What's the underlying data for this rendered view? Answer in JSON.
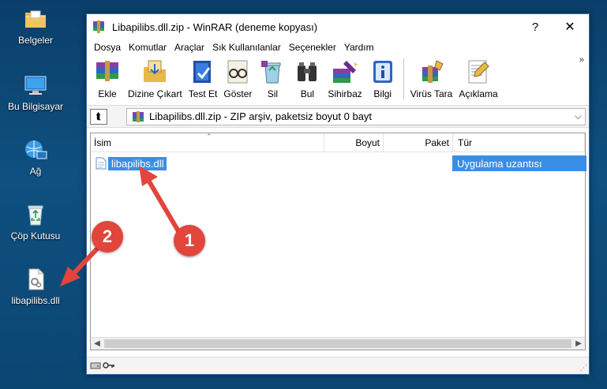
{
  "desktop": {
    "icons": [
      {
        "label": "Belgeler",
        "icon": "folder-documents-icon"
      },
      {
        "label": "Bu Bilgisayar",
        "icon": "computer-icon"
      },
      {
        "label": "Ağ",
        "icon": "network-icon"
      },
      {
        "label": "Çöp Kutusu",
        "icon": "recycle-bin-icon"
      },
      {
        "label": "libapilibs.dll",
        "icon": "dll-file-icon"
      }
    ]
  },
  "window": {
    "title": "Libapilibs.dll.zip - WinRAR (deneme kopyası)",
    "help_glyph": "?",
    "close_glyph": "✕"
  },
  "menu": [
    "Dosya",
    "Komutlar",
    "Araçlar",
    "Sık Kullanılanlar",
    "Seçenekler",
    "Yardım"
  ],
  "toolbar": [
    {
      "label": "Ekle",
      "icon": "add-books-icon"
    },
    {
      "label": "Dizine Çıkart",
      "icon": "extract-folder-icon"
    },
    {
      "label": "Test Et",
      "icon": "test-check-icon"
    },
    {
      "label": "Göster",
      "icon": "view-glasses-icon"
    },
    {
      "label": "Sil",
      "icon": "delete-recycle-icon"
    },
    {
      "label": "Bul",
      "icon": "find-binoculars-icon"
    },
    {
      "label": "Sihirbaz",
      "icon": "wizard-icon"
    },
    {
      "label": "Bilgi",
      "icon": "info-icon"
    },
    {
      "label": "Virüs Tara",
      "icon": "virus-scan-icon"
    },
    {
      "label": "Açıklama",
      "icon": "comment-pen-icon"
    }
  ],
  "toolbar_more": "»",
  "address": {
    "up_glyph": "⮬",
    "text": "Libapilibs.dll.zip - ZIP arşiv, paketsiz boyut 0 bayt",
    "dropdown_glyph": "⌵"
  },
  "columns": {
    "name": "İsim",
    "size": "Boyut",
    "packed": "Paket",
    "type": "Tür"
  },
  "files": [
    {
      "name": "libapilibs.dll",
      "type": "Uygulama uzantısı"
    }
  ],
  "annotations": {
    "badge1": "1",
    "badge2": "2",
    "color": "#e2453c"
  },
  "colors": {
    "selection": "#3a8ee6",
    "desktop": "#0f5080"
  }
}
